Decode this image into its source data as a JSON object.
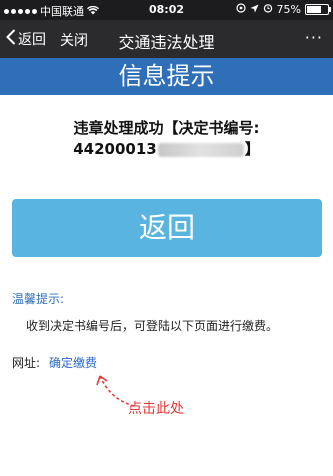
{
  "status_bar": {
    "carrier": "中国联通",
    "time": "08:02",
    "battery": "75%",
    "battery_level": 0.75
  },
  "nav": {
    "back_label": "返回",
    "close_label": "关闭",
    "title": "交通违法处理",
    "more": "···"
  },
  "banner": {
    "title": "信息提示"
  },
  "result": {
    "line1": "违章处理成功【决定书编号:",
    "number_prefix": "44200013",
    "number_suffix": "】"
  },
  "return_button": {
    "label": "返回"
  },
  "tips": {
    "title": "温馨提示:",
    "text": "收到决定书编号后，可登陆以下页面进行缴费。",
    "url_label": "网址:",
    "link": "确定缴费"
  },
  "annotation": {
    "text": "点击此处",
    "color": "#e23b3b"
  },
  "colors": {
    "banner": "#2f6fb8",
    "button": "#5ab4e0",
    "link": "#2a6bc8"
  }
}
